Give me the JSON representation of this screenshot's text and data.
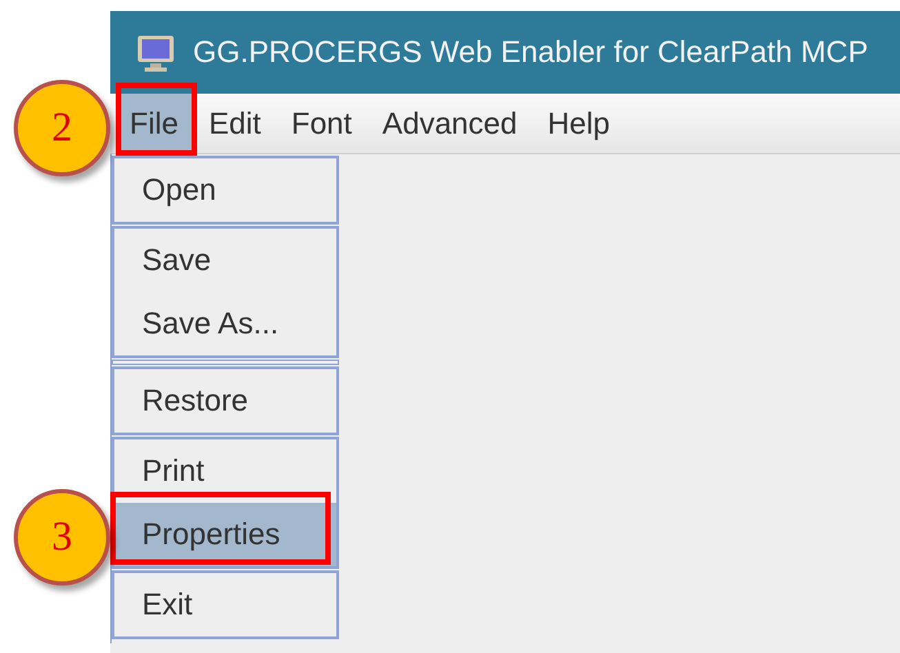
{
  "window": {
    "title": "GG.PROCERGS Web Enabler for ClearPath MCP"
  },
  "menubar": [
    {
      "label": "File",
      "selected": true
    },
    {
      "label": "Edit",
      "selected": false
    },
    {
      "label": "Font",
      "selected": false
    },
    {
      "label": "Advanced",
      "selected": false
    },
    {
      "label": "Help",
      "selected": false
    }
  ],
  "file_menu": {
    "groups": [
      {
        "kind": "items",
        "items": [
          {
            "label": "Open",
            "selected": false
          }
        ]
      },
      {
        "kind": "items",
        "items": [
          {
            "label": "Save",
            "selected": false
          },
          {
            "label": "Save As...",
            "selected": false
          }
        ]
      },
      {
        "kind": "separator"
      },
      {
        "kind": "items",
        "items": [
          {
            "label": "Restore",
            "selected": false
          }
        ]
      },
      {
        "kind": "items",
        "items": [
          {
            "label": "Print",
            "selected": false
          },
          {
            "label": "Properties",
            "selected": true
          }
        ]
      },
      {
        "kind": "items",
        "items": [
          {
            "label": "Exit",
            "selected": false
          }
        ]
      }
    ]
  },
  "callouts": [
    {
      "number": "2",
      "kind": "menubar"
    },
    {
      "number": "3",
      "kind": "menuitem"
    }
  ]
}
